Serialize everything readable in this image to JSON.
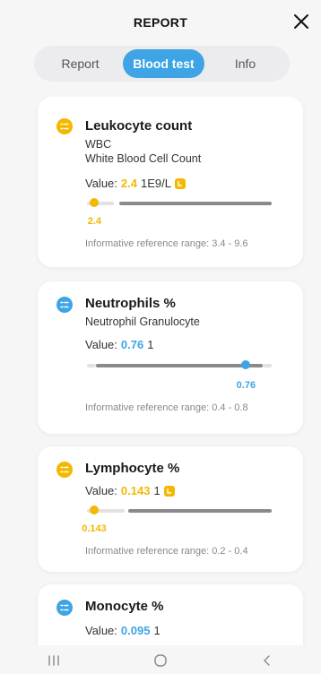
{
  "header": {
    "title": "REPORT"
  },
  "tabs": [
    {
      "label": "Report",
      "active": false
    },
    {
      "label": "Blood test",
      "active": true
    },
    {
      "label": "Info",
      "active": false
    }
  ],
  "colors": {
    "accent": "#3ea4e6",
    "warning": "#f4b800",
    "track": "#8a8a8a",
    "track_light": "#e2e2e2"
  },
  "cards": [
    {
      "title": "Leukocyte count",
      "subtitle": "WBC",
      "subtitle2": "White Blood Cell Count",
      "value_label": "Value:",
      "value": "2.4",
      "unit": "1E9/L",
      "status": "warning",
      "marker_label": "2.4",
      "marker_fraction": 0.04,
      "reference": "Informative reference range: 3.4 - 9.6"
    },
    {
      "title": "Neutrophils %",
      "subtitle": "Neutrophil Granulocyte",
      "value_label": "Value:",
      "value": "0.76",
      "unit": "1",
      "status": "normal",
      "marker_label": "0.76",
      "marker_fraction": 0.86,
      "reference": "Informative reference range: 0.4 - 0.8"
    },
    {
      "title": "Lymphocyte %",
      "value_label": "Value:",
      "value": "0.143",
      "unit": "1",
      "status": "warning",
      "marker_label": "0.143",
      "marker_fraction": 0.04,
      "reference": "Informative reference range: 0.2 - 0.4"
    },
    {
      "title": "Monocyte %",
      "value_label": "Value:",
      "value": "0.095",
      "unit": "1",
      "status": "normal"
    }
  ],
  "navbar": {
    "icons": [
      "recent-apps-icon",
      "home-icon",
      "back-icon"
    ]
  }
}
